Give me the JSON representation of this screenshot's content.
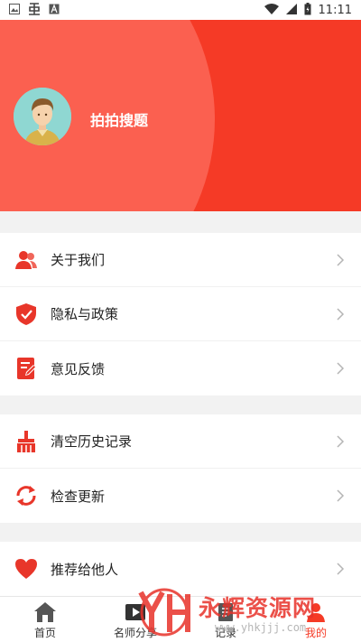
{
  "status_bar": {
    "time": "11:11",
    "icons": [
      "image-icon",
      "notification-app-icon",
      "text-icon",
      "wifi-icon",
      "signal-icon",
      "battery-icon"
    ]
  },
  "profile": {
    "username": "拍拍搜题",
    "avatar": "avatar-illustration"
  },
  "menu_groups": [
    [
      {
        "label": "关于我们",
        "icon": "users-icon"
      },
      {
        "label": "隐私与政策",
        "icon": "shield-check-icon"
      },
      {
        "label": "意见反馈",
        "icon": "edit-note-icon"
      }
    ],
    [
      {
        "label": "清空历史记录",
        "icon": "broom-icon"
      },
      {
        "label": "检查更新",
        "icon": "refresh-icon"
      }
    ],
    [
      {
        "label": "推荐给他人",
        "icon": "heart-icon"
      }
    ]
  ],
  "tab_bar": {
    "tabs": [
      {
        "label": "首页",
        "icon": "home-icon"
      },
      {
        "label": "名师分享",
        "icon": "video-icon"
      },
      {
        "label": "记录",
        "icon": "record-icon"
      },
      {
        "label": "我的",
        "icon": "profile-icon"
      }
    ],
    "active_index": 3
  },
  "watermark": {
    "text": "永辉资源网",
    "url": "www.yhkjjj.com"
  },
  "colors": {
    "accent": "#f53a26",
    "header_light": "#fb6050",
    "avatar_bg": "#8fd7d2"
  }
}
